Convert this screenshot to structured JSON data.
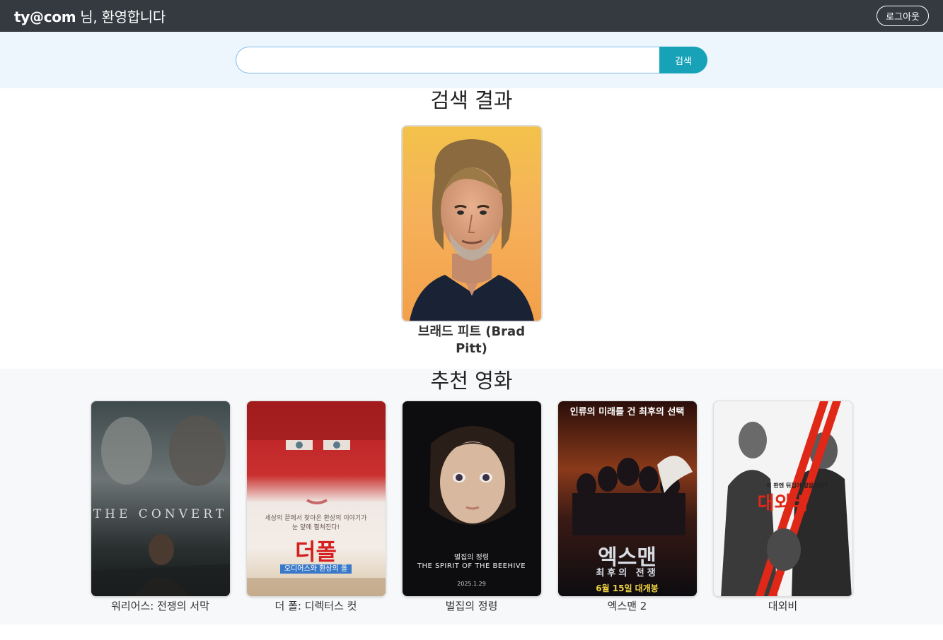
{
  "header": {
    "user": "ty@com",
    "welcome_suffix": " 님, 환영합니다",
    "logout_label": "로그아웃"
  },
  "search": {
    "value": "",
    "placeholder": "",
    "button_label": "검색"
  },
  "results": {
    "title": "검색 결과",
    "person": {
      "name": "브래드 피트 (Brad Pitt)"
    }
  },
  "recommended": {
    "title": "추천 영화",
    "movies": [
      {
        "title": "워리어스: 전쟁의 서막",
        "poster_text": "THE CONVERT"
      },
      {
        "title": "더 폴: 디렉터스 컷",
        "poster_tagline": "세상의 끝에서 찾아온 환상의 이야기가 눈 앞에 펼쳐진다!",
        "poster_text": "더폴",
        "poster_sub": "오디어스와 환상의 폴"
      },
      {
        "title": "벌집의 정령",
        "poster_text": "벌집의 정령",
        "poster_sub": "THE SPIRIT OF THE BEEHIVE",
        "poster_date": "2025.1.29"
      },
      {
        "title": "엑스맨 2",
        "poster_tagline": "인류의 미래를 건 최후의 선택",
        "poster_text": "엑스맨",
        "poster_sub": "최후의 전쟁",
        "poster_date": "6월 15일 대개봉"
      },
      {
        "title": "대외비",
        "poster_tagline": "이 판엔 뒤집어 엎을까요?",
        "poster_text": "대외비"
      }
    ]
  }
}
